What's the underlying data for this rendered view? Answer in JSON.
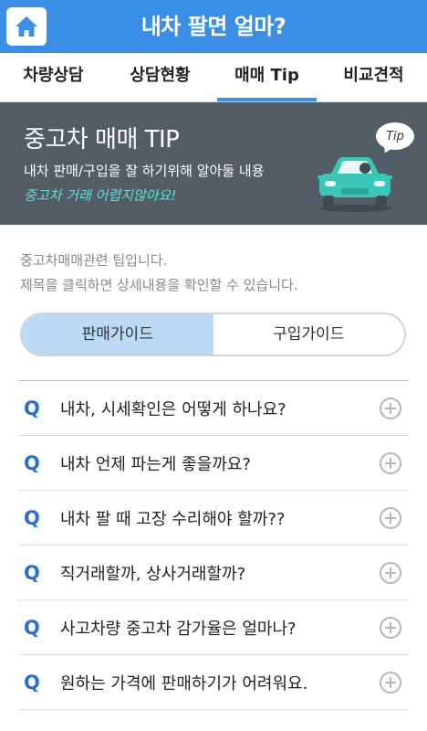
{
  "header": {
    "title": "내차 팔면 얼마?",
    "home_icon": "home-icon"
  },
  "tabs": [
    {
      "label": "차량상담",
      "active": false
    },
    {
      "label": "상담현황",
      "active": false
    },
    {
      "label": "매매 Tip",
      "active": true
    },
    {
      "label": "비교견적",
      "active": false
    }
  ],
  "banner": {
    "title": "중고차 매매 TIP",
    "description": "내차 판매/구입을 잘 하기위해 알아둘 내용",
    "handwritten": "중고차 거래 어렵지않아요!",
    "tip_bubble": "Tip",
    "car_icon": "car-icon"
  },
  "intro": {
    "line1": "중고차매매관련 팁입니다.",
    "line2": "제목을 클릭하면 상세내용을 확인할 수 있습니다."
  },
  "guide_toggle": {
    "sell": "판매가이드",
    "buy": "구입가이드",
    "selected": "sell"
  },
  "faq": {
    "marker": "Q",
    "items": [
      "내차, 시세확인은 어떻게 하나요?",
      "내차 언제 파는게 좋을까요?",
      "내차 팔 때 고장 수리해야 할까??",
      "직거래할까, 상사거래할까?",
      "사고차량 중고차 감가율은 얼마나?",
      "원하는 가격에 판매하기가 어려워요."
    ]
  },
  "colors": {
    "header": "#3a8ee6",
    "banner": "#525d66",
    "accent_text": "#5fe0d6",
    "toggle_active": "#bcd9f5",
    "q_marker": "#2a6fd0"
  }
}
